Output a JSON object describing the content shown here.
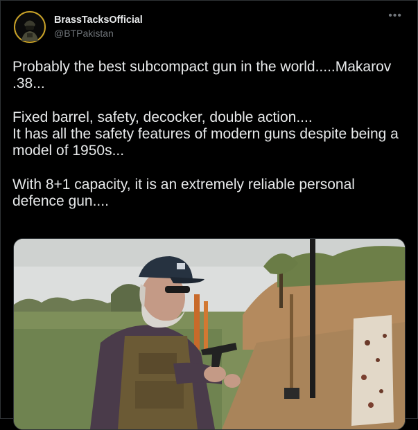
{
  "tweet": {
    "display_name": "BrassTacksOfficial",
    "handle": "@BTPakistan",
    "text": "Probably the best subcompact gun in the world.....Makarov .38...\n\nFixed barrel, safety, decocker, double action....\nIt has all the safety features of modern guns despite being a model of 1950s...\n\nWith 8+1 capacity, it is an extremely reliable personal defence gun...."
  },
  "icons": {
    "more": "more-options-icon",
    "avatar": "soldier-avatar"
  },
  "colors": {
    "background": "#000000",
    "text_primary": "#e7e9ea",
    "text_secondary": "#71767b",
    "border": "#2f3336"
  }
}
